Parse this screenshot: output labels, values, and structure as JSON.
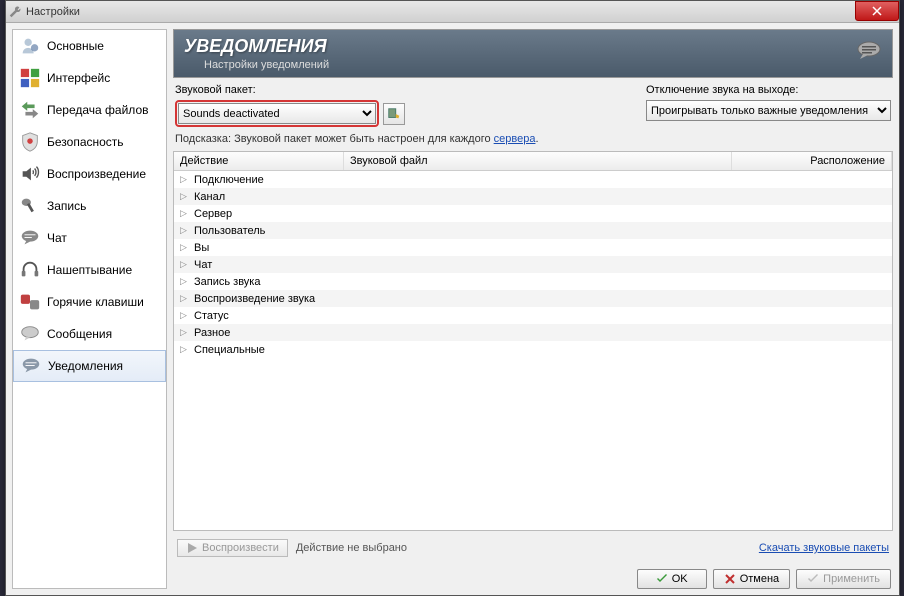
{
  "window": {
    "title": "Настройки"
  },
  "sidebar": {
    "items": [
      {
        "label": "Основные"
      },
      {
        "label": "Интерфейс"
      },
      {
        "label": "Передача файлов"
      },
      {
        "label": "Безопасность"
      },
      {
        "label": "Воспроизведение"
      },
      {
        "label": "Запись"
      },
      {
        "label": "Чат"
      },
      {
        "label": "Нашептывание"
      },
      {
        "label": "Горячие клавиши"
      },
      {
        "label": "Сообщения"
      },
      {
        "label": "Уведомления"
      }
    ]
  },
  "header": {
    "title": "УВЕДОМЛЕНИЯ",
    "subtitle": "Настройки уведомлений"
  },
  "controls": {
    "sound_pack_label": "Звуковой пакет:",
    "sound_pack_selected": "Sounds deactivated",
    "mute_label": "Отключение звука на выходе:",
    "mute_selected": "Проигрывать только важные уведомления"
  },
  "hint": {
    "prefix": "Подсказка: Звуковой пакет может быть настроен для каждого ",
    "link": "сервера",
    "suffix": "."
  },
  "tree": {
    "headers": {
      "action": "Действие",
      "sound": "Звуковой файл",
      "location": "Расположение"
    },
    "rows": [
      "Подключение",
      "Канал",
      "Сервер",
      "Пользователь",
      "Вы",
      "Чат",
      "Запись звука",
      "Воспроизведение звука",
      "Статус",
      "Разное",
      "Специальные"
    ]
  },
  "bottom": {
    "play_label": "Воспроизвести",
    "status": "Действие не выбрано",
    "download_link": "Скачать звуковые пакеты"
  },
  "buttons": {
    "ok": "OK",
    "cancel": "Отмена",
    "apply": "Применить"
  }
}
